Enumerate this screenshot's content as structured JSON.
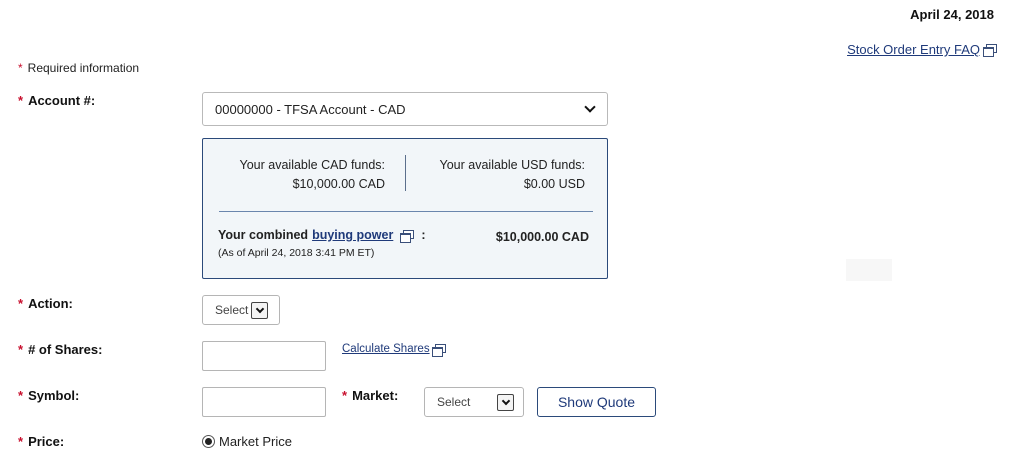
{
  "header": {
    "date": "April 24, 2018",
    "faq_link": "Stock Order Entry FAQ"
  },
  "required_note": {
    "star": "*",
    "text": "Required information"
  },
  "fields": {
    "account": {
      "label": "Account #:",
      "value": "00000000 - TFSA Account - CAD"
    },
    "action": {
      "label": "Action:",
      "value": "Select"
    },
    "shares": {
      "label": "# of Shares:",
      "value": "",
      "calc_link": "Calculate Shares"
    },
    "symbol": {
      "label": "Symbol:",
      "value": ""
    },
    "market": {
      "label": "Market:",
      "value": "Select"
    },
    "price": {
      "label": "Price:",
      "option": "Market Price",
      "selected": true
    }
  },
  "funds": {
    "cad_label": "Your available CAD funds:",
    "cad_value": "$10,000.00 CAD",
    "usd_label": "Your available USD funds:",
    "usd_value": "$0.00 USD",
    "combined_prefix": "Your combined",
    "buying_power_link": "buying power",
    "colon": ":",
    "as_of": "(As of April 24, 2018 3:41 PM ET)",
    "combined_value": "$10,000.00 CAD"
  },
  "buttons": {
    "show_quote": "Show Quote"
  },
  "colors": {
    "required_star": "#c8102e",
    "link": "#1f3a7a",
    "box_border": "#2b4a7a",
    "box_bg": "#f2f6f9"
  }
}
